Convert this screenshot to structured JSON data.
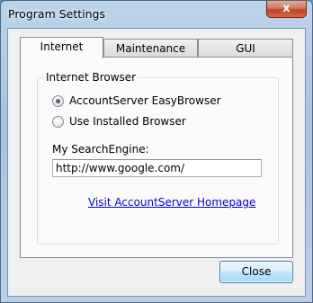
{
  "window": {
    "title": "Program Settings",
    "close_glyph": "x"
  },
  "tabs": [
    {
      "label": "Internet",
      "active": true
    },
    {
      "label": "Maintenance",
      "active": false
    },
    {
      "label": "GUI",
      "active": false
    }
  ],
  "internet_browser": {
    "group_label": "Internet Browser",
    "options": [
      {
        "label": "AccountServer EasyBrowser",
        "checked": true
      },
      {
        "label": "Use Installed Browser",
        "checked": false
      }
    ]
  },
  "search_engine": {
    "label": "My SearchEngine:",
    "value": "http://www.google.com/"
  },
  "homepage_link": "Visit AccountServer Homepage",
  "footer": {
    "close_label": "Close"
  }
}
